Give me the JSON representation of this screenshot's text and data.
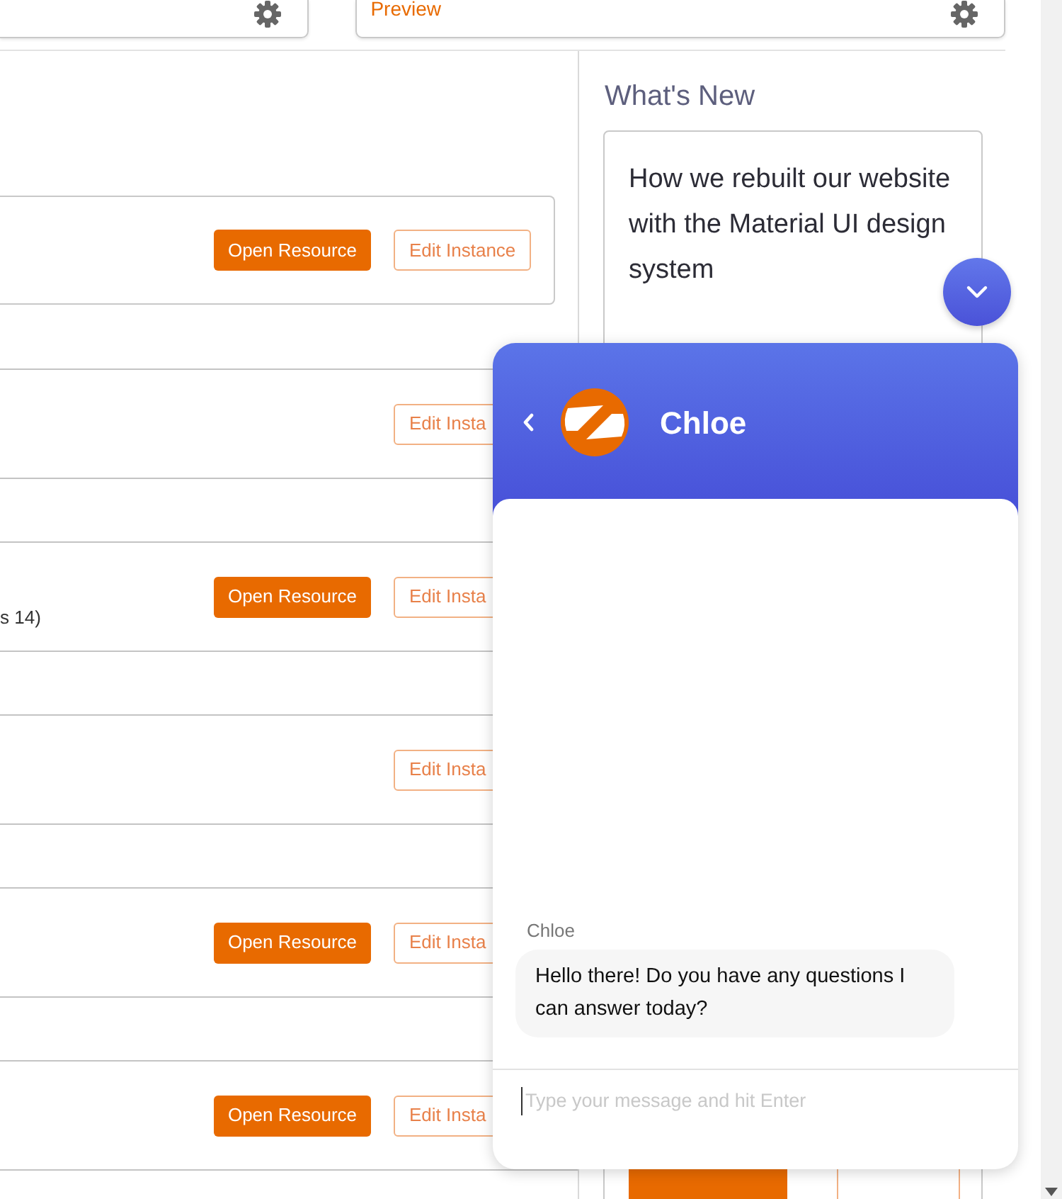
{
  "top_cards": [
    {
      "kind": "plain"
    },
    {
      "kind": "titled",
      "title": "Preview"
    }
  ],
  "resources": [
    {
      "kind": "boxed",
      "open_button": "Open Resource",
      "edit_button": "Edit Instance"
    },
    {
      "kind": "plain",
      "edit_button": "Edit Insta"
    },
    {
      "kind": "plain",
      "text": "s 14)",
      "open_button": "Open Resource",
      "edit_button": "Edit Insta"
    },
    {
      "kind": "plain",
      "edit_button": "Edit Insta"
    },
    {
      "kind": "plain",
      "open_button": "Open Resource",
      "edit_button": "Edit Insta"
    },
    {
      "kind": "plain",
      "open_button": "Open Resource",
      "edit_button": "Edit Insta"
    }
  ],
  "sidebar": {
    "heading": "What's New",
    "article_title": "How we rebuilt our website with the Material UI design system"
  },
  "chat": {
    "agent_name": "Chloe",
    "messages": [
      {
        "sender": "Chloe",
        "text": "Hello there! Do you have any questions I can answer today?"
      }
    ],
    "input": {
      "placeholder": "Type your message and hit Enter"
    }
  }
}
